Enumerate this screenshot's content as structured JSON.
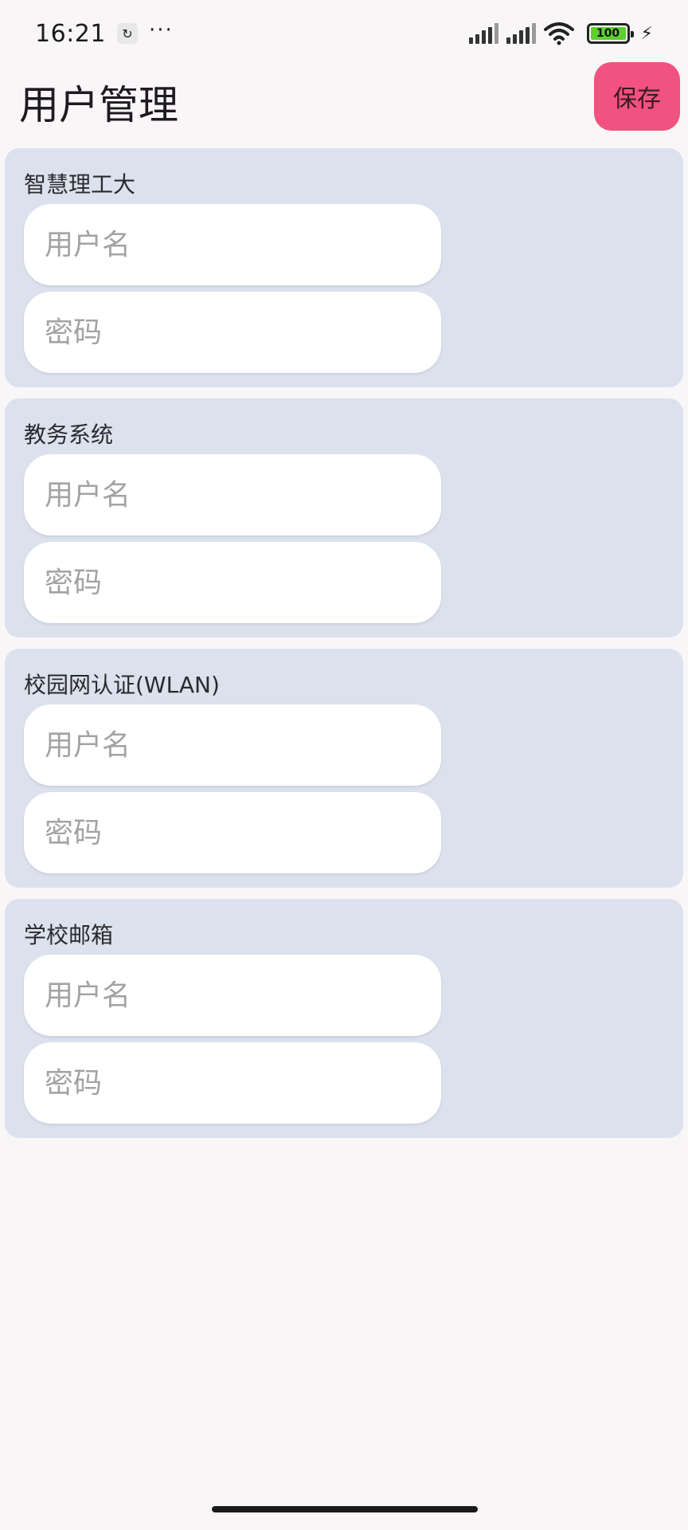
{
  "status_bar": {
    "time": "16:21",
    "more": "···",
    "battery": "100"
  },
  "header": {
    "title": "用户管理",
    "save_label": "保存"
  },
  "accounts": [
    {
      "title": "智慧理工大",
      "username_placeholder": "用户名",
      "password_placeholder": "密码"
    },
    {
      "title": "教务系统",
      "username_placeholder": "用户名",
      "password_placeholder": "密码"
    },
    {
      "title": "校园网认证(WLAN)",
      "username_placeholder": "用户名",
      "password_placeholder": "密码"
    },
    {
      "title": "学校邮箱",
      "username_placeholder": "用户名",
      "password_placeholder": "密码"
    }
  ],
  "colors": {
    "accent": "#f2527f",
    "card_background": "#dbe1ed",
    "page_background": "#f9f6f8"
  }
}
